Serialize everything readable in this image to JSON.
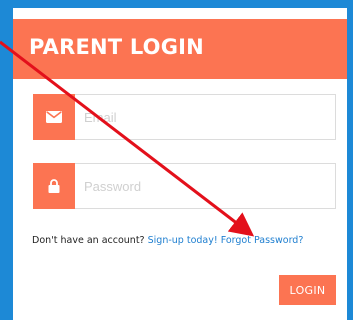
{
  "header": {
    "title": "PARENT LOGIN"
  },
  "form": {
    "email": {
      "placeholder": "Email",
      "value": "",
      "icon": "envelope-icon"
    },
    "password": {
      "placeholder": "Password",
      "value": "",
      "icon": "lock-icon"
    },
    "account_prompt": "Don't have an account?",
    "signup_link": "Sign-up today!",
    "forgot_link": "Forgot Password?",
    "login_button": "LOGIN"
  },
  "colors": {
    "accent": "#fc7452",
    "frame": "#1d89d6",
    "link": "#1f7fd0",
    "annotation_arrow": "#e3101b"
  }
}
